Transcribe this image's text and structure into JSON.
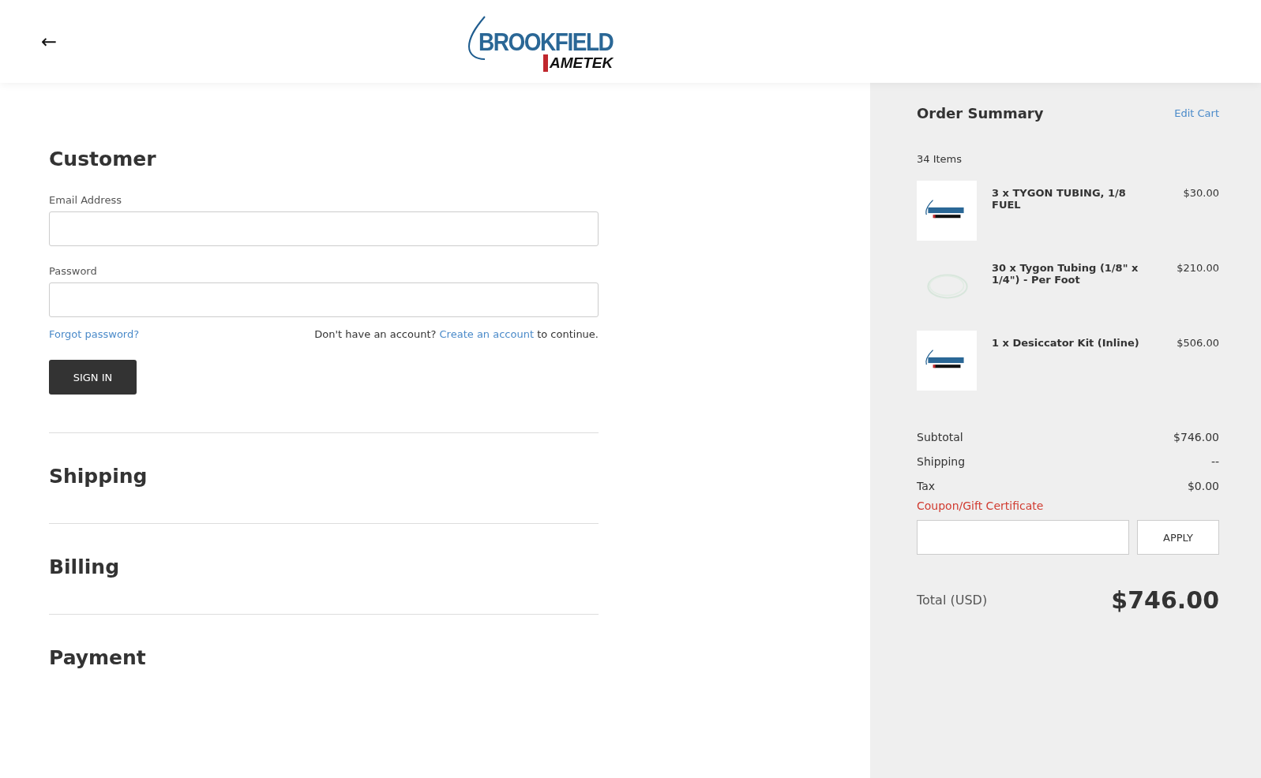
{
  "header": {
    "back_icon": "←",
    "logo": {
      "top": "BROOKFIELD",
      "bottom": "AMETEK"
    }
  },
  "customer": {
    "title": "Customer",
    "email": {
      "label": "Email Address"
    },
    "password": {
      "label": "Password"
    },
    "forgot": "Forgot password?",
    "signup": {
      "before": "Don't have an account?",
      "link": "Create an account",
      "after": "to continue."
    },
    "button": "SIGN IN"
  },
  "sections": [
    "Shipping",
    "Billing",
    "Payment"
  ],
  "summary": {
    "title": "Order Summary",
    "edit": "Edit Cart",
    "count": "34 Items",
    "items": [
      {
        "name": "3 x TYGON TUBING, 1/8 FUEL",
        "price": "$30.00",
        "kind": "logo"
      },
      {
        "name": "30 x Tygon Tubing (1/8\" x 1/4\") - Per Foot",
        "price": "$210.00",
        "kind": "tubing"
      },
      {
        "name": "1 x Desiccator Kit (Inline)",
        "price": "$506.00",
        "kind": "logo"
      }
    ],
    "lines": [
      {
        "label": "Subtotal",
        "value": "$746.00"
      },
      {
        "label": "Shipping",
        "value": "--"
      },
      {
        "label": "Tax",
        "value": "$0.00"
      }
    ],
    "coupon": {
      "label": "Coupon/Gift Certificate",
      "button": "APPLY"
    },
    "total": {
      "label": "Total (USD)",
      "value": "$746.00"
    }
  }
}
